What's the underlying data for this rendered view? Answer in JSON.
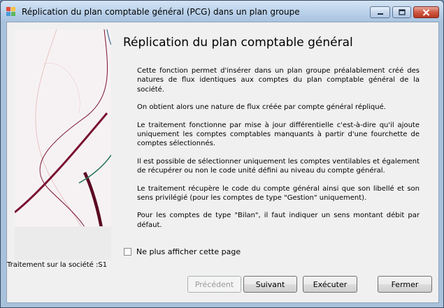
{
  "window": {
    "title": "Réplication du plan comptable général (PCG) dans un plan groupe"
  },
  "page": {
    "heading": "Réplication du plan comptable général",
    "paragraphs": [
      "Cette fonction permet d'insérer dans un plan groupe préalablement créé des natures de flux identiques aux comptes du plan comptable général de la société.",
      "On obtient alors une nature de flux créée par compte général répliqué.",
      "Le traitement fonctionne par mise à jour différentielle c'est-à-dire qu'il ajoute uniquement les comptes comptables manquants à partir d'une fourchette de comptes sélectionnés.",
      "Il est possible de sélectionner uniquement les comptes ventilables et également de récupérer ou non le code unité défini au niveau du compte général.",
      "Le traitement récupère le code du compte général ainsi que son libellé et son sens privilégié (pour les comptes de type \"Gestion\" uniquement).",
      "Pour les comptes de type \"Bilan\", il faut indiquer un sens montant débit par défaut."
    ],
    "checkbox_label": "Ne plus afficher cette page",
    "checkbox_checked": false,
    "status": "Traitement sur la société :S1"
  },
  "buttons": {
    "previous": "Précédent",
    "next": "Suivant",
    "execute": "Exécuter",
    "close": "Fermer"
  },
  "colors": {
    "curve_dark_red": "#7a1030",
    "curve_green": "#2f7a5a",
    "curve_pink": "#e0a0a8"
  }
}
